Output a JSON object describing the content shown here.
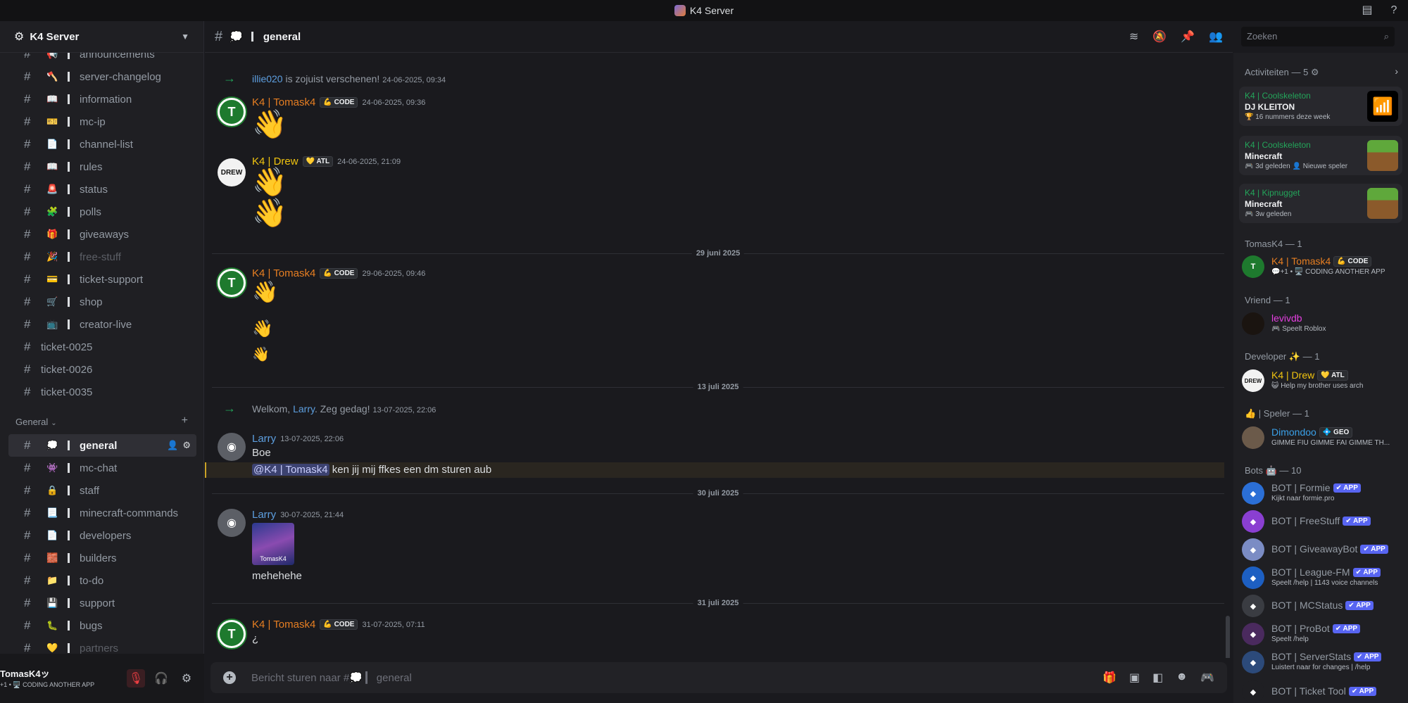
{
  "window": {
    "title": "K4 Server"
  },
  "server": {
    "name": "K4 Server"
  },
  "channels_top": [
    {
      "emoji": "📢",
      "name": "announcements",
      "muted": false
    },
    {
      "emoji": "🪓",
      "name": "server-changelog",
      "muted": false
    },
    {
      "emoji": "📖",
      "name": "information",
      "muted": false
    },
    {
      "emoji": "🎫",
      "name": "mc-ip",
      "muted": false
    },
    {
      "emoji": "📄",
      "name": "channel-list",
      "muted": false
    },
    {
      "emoji": "📖",
      "name": "rules",
      "muted": false
    },
    {
      "emoji": "🚨",
      "name": "status",
      "muted": false
    },
    {
      "emoji": "🧩",
      "name": "polls",
      "muted": false
    },
    {
      "emoji": "🎁",
      "name": "giveaways",
      "muted": false
    },
    {
      "emoji": "🎉",
      "name": "free-stuff",
      "muted": true
    },
    {
      "emoji": "💳",
      "name": "ticket-support",
      "muted": false
    },
    {
      "emoji": "🛒",
      "name": "shop",
      "muted": false
    },
    {
      "emoji": "📺",
      "name": "creator-live",
      "muted": false
    }
  ],
  "tickets": [
    "ticket-0025",
    "ticket-0026",
    "ticket-0035"
  ],
  "category_general": "General",
  "channels_general": [
    {
      "emoji": "💭",
      "name": "general",
      "active": true,
      "muted": false
    },
    {
      "emoji": "👾",
      "name": "mc-chat",
      "active": false,
      "muted": false
    },
    {
      "emoji": "🔒",
      "name": "staff",
      "active": false,
      "muted": false
    },
    {
      "emoji": "📃",
      "name": "minecraft-commands",
      "active": false,
      "muted": false
    },
    {
      "emoji": "📄",
      "name": "developers",
      "active": false,
      "muted": false
    },
    {
      "emoji": "🧱",
      "name": "builders",
      "active": false,
      "muted": false
    },
    {
      "emoji": "📁",
      "name": "to-do",
      "active": false,
      "muted": false
    },
    {
      "emoji": "💾",
      "name": "support",
      "active": false,
      "muted": false
    },
    {
      "emoji": "🐛",
      "name": "bugs",
      "active": false,
      "muted": false
    },
    {
      "emoji": "💛",
      "name": "partners",
      "active": false,
      "muted": true
    }
  ],
  "user": {
    "name": "TomasK4ッ",
    "status": "+1 • 🖥️ CODING ANOTHER APP"
  },
  "header": {
    "channel_emoji": "💭",
    "channel_name": "general"
  },
  "search": {
    "placeholder": "Zoeken"
  },
  "messages": {
    "sys1": {
      "user": "illie020",
      "text": " is zojuist verschenen! ",
      "time": "24-06-2025, 09:34"
    },
    "m1": {
      "author": "K4 | Tomask4",
      "tag": "💪 CODE",
      "time": "24-06-2025, 09:36"
    },
    "m2": {
      "author": "K4 | Drew",
      "tag": "💛 ATL",
      "time": "24-06-2025, 21:09"
    },
    "d1": "29 juni 2025",
    "m3": {
      "author": "K4 | Tomask4",
      "tag": "💪 CODE",
      "time": "29-06-2025, 09:46"
    },
    "d2": "13 juli 2025",
    "sys2": {
      "pre": "Welkom, ",
      "user": "Larry",
      "post": ". Zeg gedag! ",
      "time": "13-07-2025, 22:06"
    },
    "m4": {
      "author": "Larry",
      "time": "13-07-2025, 22:06",
      "line1": "Boe",
      "mention": "@K4 | Tomask4",
      "line2": " ken jij mij ffkes een dm sturen aub"
    },
    "d3": "30 juli 2025",
    "m5": {
      "author": "Larry",
      "time": "30-07-2025, 21:44",
      "img_caption": "TomasK4",
      "text": "mehehehe"
    },
    "d4": "31 juli 2025",
    "m6": {
      "author": "K4 | Tomask4",
      "tag": "💪 CODE",
      "time": "31-07-2025, 07:11",
      "text": "¿"
    }
  },
  "composer": {
    "placeholder": "Bericht sturen naar #💭 ▎ general"
  },
  "members": {
    "activity_title": "Activiteiten — 5 ⚙",
    "activities": [
      {
        "who": "K4 | Coolskeleton",
        "what": "DJ KLEITON",
        "sub": "🏆 16 nummers deze week",
        "thumb": "wifi"
      },
      {
        "who": "K4 | Coolskeleton",
        "what": "Minecraft",
        "sub": "🎮 3d geleden  👤 Nieuwe speler",
        "thumb": "mc"
      },
      {
        "who": "K4 | Kipnugget",
        "what": "Minecraft",
        "sub": "🎮 3w geleden",
        "thumb": "mc"
      }
    ],
    "sec_tomas": "TomasK4 — 1",
    "tomas": {
      "name": "K4 | Tomask4",
      "tag": "💪 CODE",
      "status": "💬+1 • 🖥️ CODING ANOTHER APP"
    },
    "sec_vriend": "Vriend — 1",
    "levi": {
      "name": "levivdb",
      "status": "🎮 Speelt Roblox"
    },
    "sec_dev": "Developer ✨ — 1",
    "drew": {
      "name": "K4 | Drew",
      "tag": "💛 ATL",
      "status": "😺 Help my brother uses arch"
    },
    "sec_speler": "👍 | Speler — 1",
    "dimon": {
      "name": "Dimondoo",
      "tag": "💠 GEO",
      "status": "GIMME FIU GIMME FAI GIMME TH..."
    },
    "sec_bots": "Bots 🤖 — 10",
    "bots": [
      {
        "name": "BOT | Formie",
        "status": "Kijkt naar formie.pro",
        "color": "#2b6fd6"
      },
      {
        "name": "BOT | FreeStuff",
        "status": "",
        "color": "#8a3fd1"
      },
      {
        "name": "BOT | GiveawayBot",
        "status": "",
        "color": "#7b8cc4"
      },
      {
        "name": "BOT | League-FM",
        "status": "Speelt /help | 1143 voice channels",
        "color": "#1d5fc2"
      },
      {
        "name": "BOT | MCStatus",
        "status": "",
        "color": "#3a3c42"
      },
      {
        "name": "BOT | ProBot",
        "status": "Speelt /help",
        "color": "#4a2a5e"
      },
      {
        "name": "BOT | ServerStats",
        "status": "Luistert naar for changes | /help",
        "color": "#2c4a7a"
      },
      {
        "name": "BOT | Ticket Tool",
        "status": "",
        "color": "#1f1f23"
      }
    ],
    "app_label": "✔ APP"
  }
}
